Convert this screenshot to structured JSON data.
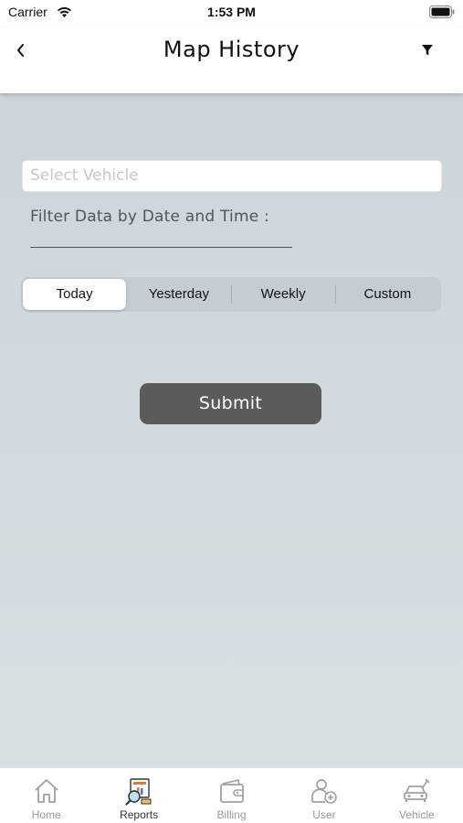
{
  "status_bar": {
    "carrier": "Carrier",
    "time": "1:53 PM"
  },
  "header": {
    "title": "Map History",
    "back_icon": "chevron-left-icon",
    "filter_icon": "funnel-icon"
  },
  "form": {
    "vehicle_placeholder": "Select Vehicle",
    "filter_label": "Filter Data by Date and Time :",
    "segments": [
      {
        "label": "Today",
        "selected": true
      },
      {
        "label": "Yesterday",
        "selected": false
      },
      {
        "label": "Weekly",
        "selected": false
      },
      {
        "label": "Custom",
        "selected": false
      }
    ],
    "submit_label": "Submit"
  },
  "tab_bar": {
    "items": [
      {
        "label": "Home",
        "icon": "home-icon",
        "active": false
      },
      {
        "label": "Reports",
        "icon": "reports-icon",
        "active": true
      },
      {
        "label": "Billing",
        "icon": "wallet-icon",
        "active": false
      },
      {
        "label": "User",
        "icon": "user-add-icon",
        "active": false
      },
      {
        "label": "Vehicle",
        "icon": "car-service-icon",
        "active": false
      }
    ]
  },
  "colors": {
    "background": "#d2dadf",
    "submit": "#5b5b5b",
    "segment_track": "#c5cdd2",
    "reports_accent": "#e07b39"
  }
}
